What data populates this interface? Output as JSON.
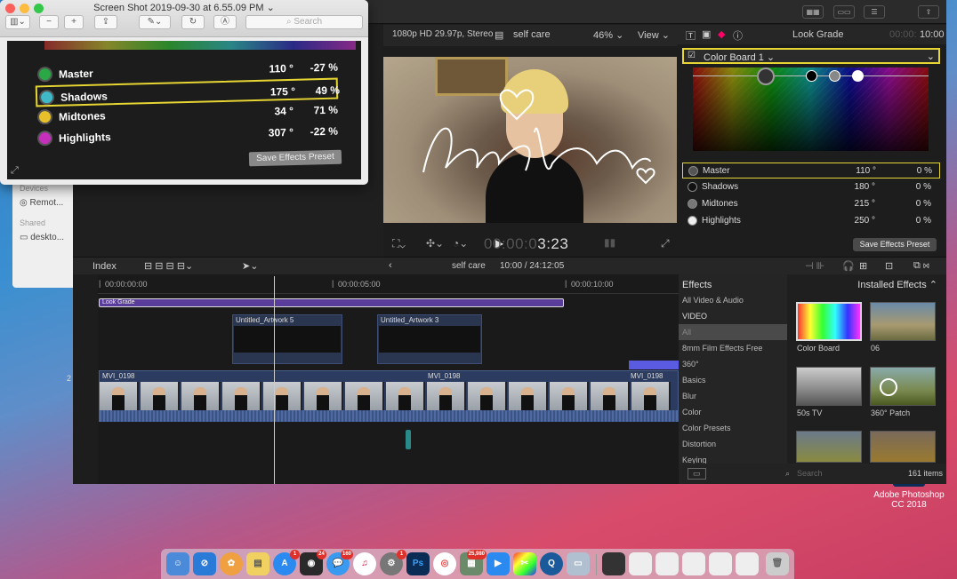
{
  "preview": {
    "title": "Screen Shot 2019-09-30 at 6.55.09 PM",
    "search_placeholder": "Search",
    "rows": [
      {
        "label": "Master",
        "angle": "110 °",
        "percent": "-27 %",
        "color": "#2aa845"
      },
      {
        "label": "Shadows",
        "angle": "175 °",
        "percent": "49 %",
        "color": "#3fb9c8"
      },
      {
        "label": "Midtones",
        "angle": "34 °",
        "percent": "71 %",
        "color": "#e8c12a"
      },
      {
        "label": "Highlights",
        "angle": "307 °",
        "percent": "-22 %",
        "color": "#c62fbb"
      }
    ],
    "save": "Save Effects Preset"
  },
  "finder": {
    "devices": "Devices",
    "remote": "Remot...",
    "shared": "Shared",
    "desktop": "deskto..."
  },
  "viewer": {
    "format": "1080p HD 29.97p, Stereo",
    "project": "self care",
    "zoom": "46%",
    "view": "View",
    "timecode": "00:00:03:23",
    "timecode_dim": "00:0",
    "timecode_bright": "3:23"
  },
  "inspector": {
    "title": "Look Grade",
    "time": "10:00",
    "time_dim": "00:00:",
    "colorboard": "Color Board 1",
    "rows": [
      {
        "label": "Master",
        "angle": "110 °",
        "percent": "0  %"
      },
      {
        "label": "Shadows",
        "angle": "180 °",
        "percent": "0  %"
      },
      {
        "label": "Midtones",
        "angle": "215 °",
        "percent": "0  %"
      },
      {
        "label": "Highlights",
        "angle": "250 °",
        "percent": "0  %"
      }
    ],
    "save": "Save Effects Preset"
  },
  "timeline": {
    "index": "Index",
    "project": "self care",
    "duration": "10:00 / 24:12:05",
    "ticks": [
      "00:00:00:00",
      "00:00:05:00",
      "00:00:10:00"
    ],
    "lookgrade": "Look Grade",
    "art1": "Untitled_Artwork 5",
    "art2": "Untitled_Artwork 3",
    "clip": "MVI_0198",
    "clip2": "MVI_0198",
    "clip3": "MVI_0198"
  },
  "effects": {
    "header": "Effects",
    "installed": "Installed Effects",
    "categories": [
      "All Video & Audio",
      "VIDEO",
      "All",
      "8mm Film Effects Free",
      "360°",
      "Basics",
      "Blur",
      "Color",
      "Color Presets",
      "Distortion",
      "Keying"
    ],
    "tiles": [
      "Color Board",
      "06",
      "50s TV",
      "360° Patch"
    ],
    "search_placeholder": "Search",
    "count": "161 items"
  },
  "desktop": {
    "ps_label": "Adobe Photoshop CC 2018",
    "stray": "2"
  },
  "dock": {
    "badges": [
      "1",
      "24",
      "160",
      "1",
      "25,980"
    ]
  },
  "colors": {
    "accent": "#e6d532",
    "lookgrade": "#5a3c9a"
  }
}
